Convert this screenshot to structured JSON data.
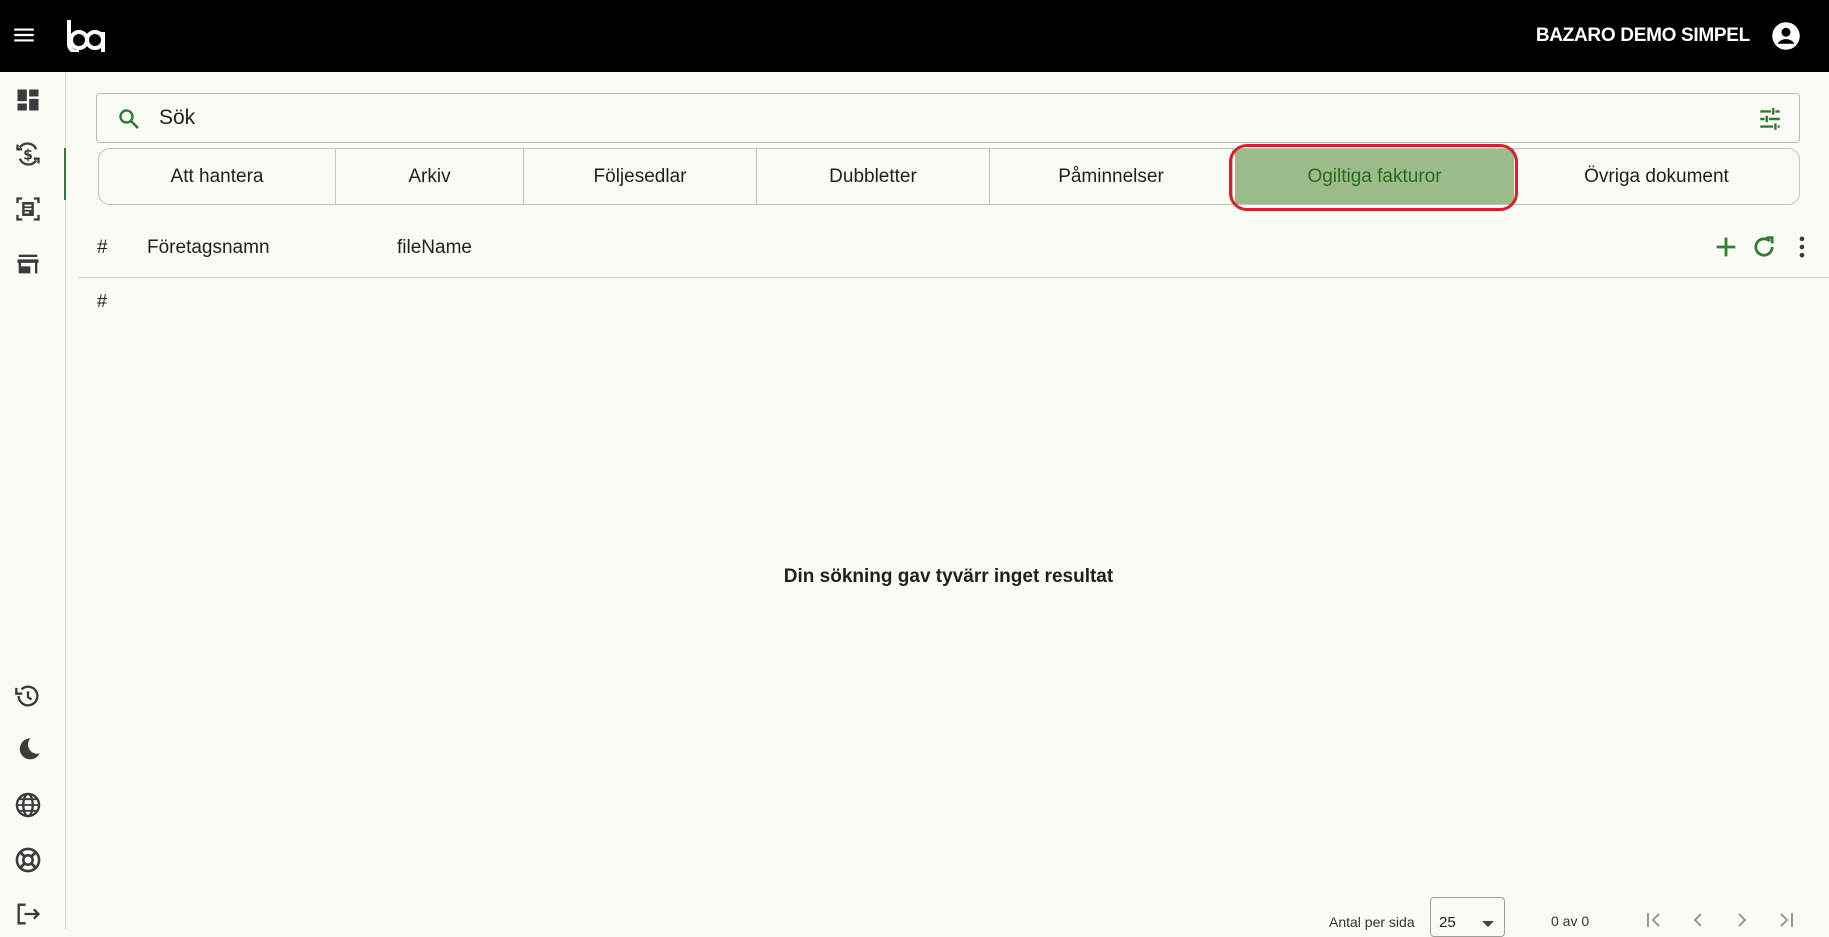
{
  "header": {
    "company": "BAZARO DEMO SIMPEL",
    "menu_icon": "menu-icon",
    "logo": "bazaro-logo",
    "account_icon": "account-circle-icon"
  },
  "sidebar": {
    "top_items": [
      {
        "icon": "dashboard-icon"
      },
      {
        "icon": "invoice-currency-icon",
        "active": true
      },
      {
        "icon": "document-scan-icon"
      },
      {
        "icon": "store-icon"
      }
    ],
    "bottom_items": [
      {
        "icon": "history-icon"
      },
      {
        "icon": "dark-mode-icon"
      },
      {
        "icon": "language-icon"
      },
      {
        "icon": "support-icon"
      },
      {
        "icon": "logout-icon"
      }
    ]
  },
  "search": {
    "placeholder": "Sök",
    "value": ""
  },
  "tabs": [
    {
      "label": "Att hantera"
    },
    {
      "label": "Arkiv"
    },
    {
      "label": "Följesedlar"
    },
    {
      "label": "Dubbletter"
    },
    {
      "label": "Påminnelser"
    },
    {
      "label": "Ogiltiga fakturor",
      "active": true
    },
    {
      "label": "Övriga dokument"
    }
  ],
  "table": {
    "columns": [
      "#",
      "Företagsnamn",
      "fileName"
    ],
    "row_marker": "#",
    "empty_message": "Din sökning gav tyvärr inget resultat"
  },
  "pagination": {
    "per_page_label": "Antal per sida",
    "per_page_value": "25",
    "range_text": "0 av 0"
  },
  "colors": {
    "accent": "#2e7d32",
    "active_tab_bg": "#9bbb8a",
    "highlight": "#d8202a"
  }
}
